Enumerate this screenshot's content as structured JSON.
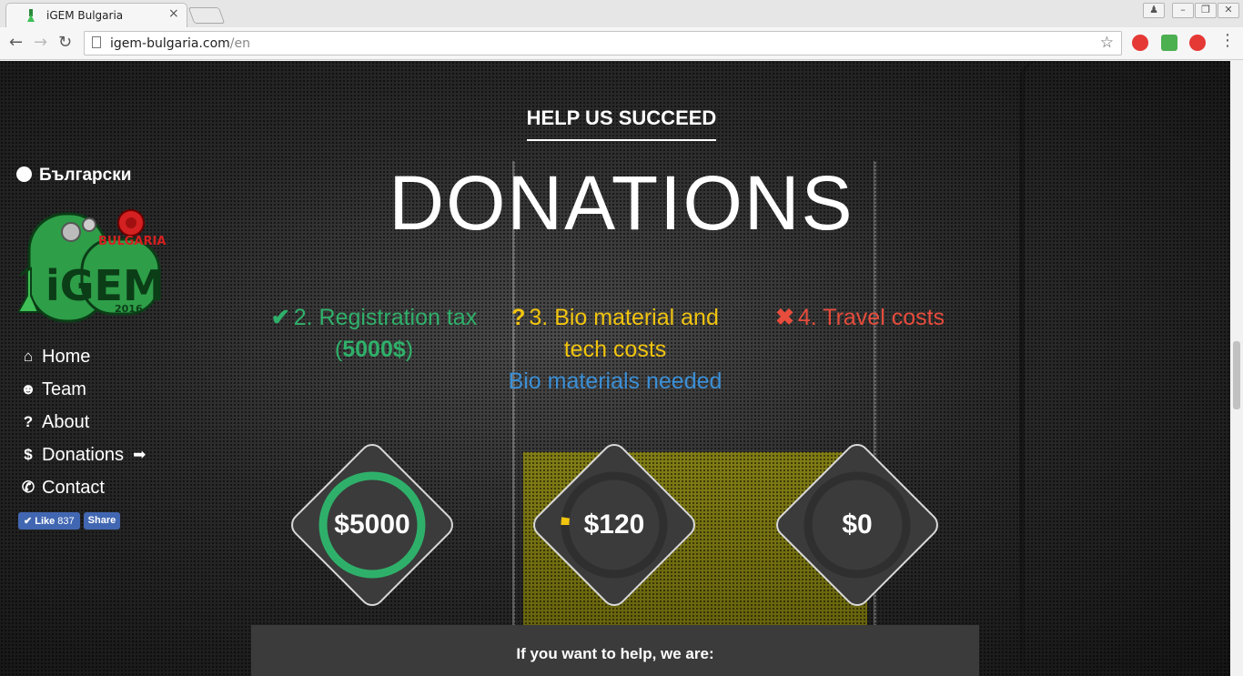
{
  "browser": {
    "tab_title": "iGEM Bulgaria",
    "url_host": "igem-bulgaria.com",
    "url_path": "/en",
    "back_icon": "arrow-left-icon",
    "forward_icon": "arrow-right-icon",
    "reload_icon": "reload-icon",
    "star_icon": "star-icon"
  },
  "sidebar": {
    "language": "Български",
    "logo_text": "iGEM",
    "logo_country": "BULGARIA",
    "logo_year": "2016",
    "menu": [
      {
        "label": "Home",
        "icon": "home-icon",
        "glyph": "⌂"
      },
      {
        "label": "Team",
        "icon": "users-icon",
        "glyph": "☻"
      },
      {
        "label": "About",
        "icon": "question-icon",
        "glyph": "?"
      },
      {
        "label": "Donations",
        "icon": "dollar-icon",
        "glyph": "$",
        "active_arrow": "➡"
      },
      {
        "label": "Contact",
        "icon": "phone-icon",
        "glyph": "✆"
      }
    ],
    "facebook": {
      "like_label": "Like",
      "like_count": "837",
      "share_label": "Share"
    }
  },
  "main": {
    "eyebrow": "HELP US SUCCEED",
    "title": "DONATIONS",
    "goals": [
      {
        "icon": "check-icon",
        "glyph": "✔",
        "title": "2. Registration tax",
        "detail_open": "(",
        "amount": "5000$",
        "detail_close": ")",
        "color": "#2fb06a"
      },
      {
        "icon": "question-icon",
        "glyph": "?",
        "title": "3. Bio material and tech costs",
        "sub": "Bio materials needed",
        "color": "#f1c40f"
      },
      {
        "icon": "times-icon",
        "glyph": "✖",
        "title": "4. Travel costs",
        "color": "#e74c3c"
      }
    ],
    "progress": [
      {
        "amount": "$5000",
        "fraction": 1.0,
        "color": "#2fb06a"
      },
      {
        "amount": "$120",
        "fraction": 0.024,
        "color": "#f1c40f"
      },
      {
        "amount": "$0",
        "fraction": 0.0,
        "color": "#e74c3c"
      }
    ],
    "help_text": "If you want to help, we are:"
  }
}
